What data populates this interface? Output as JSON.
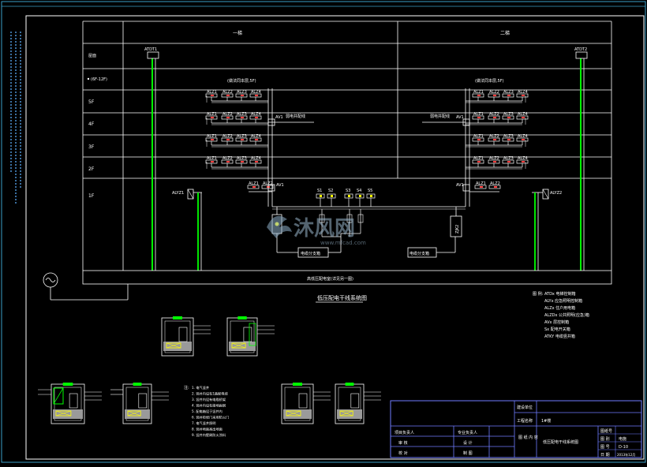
{
  "header": {
    "zone_left": "一梯",
    "zone_right": "二梯"
  },
  "floor_labels": [
    "屋面",
    "(6F-12F)",
    "5F",
    "4F",
    "3F",
    "2F",
    "1F"
  ],
  "risers": {
    "left_top": "ATDT1",
    "right_top": "ATDT2",
    "left_1f": "ALYZ1",
    "right_1f": "ALYZ2"
  },
  "group_notes": {
    "left": "(做法同本层,5F)",
    "right": "(做法同本层,5F)",
    "left_side": "弱电井配线",
    "right_side": "弱电井配线"
  },
  "meter_boxes": [
    "ALZ1",
    "ALZ2",
    "ALZ3",
    "ALZ4"
  ],
  "meter_boxes_1f_left": [
    "ALZ1",
    "ALZ2"
  ],
  "meter_boxes_1f_right": [
    "ALZ1",
    "ALZ2"
  ],
  "floor_box_left": "AV1",
  "floor_box_right": "AV1",
  "switches": [
    "S1",
    "S2",
    "S3",
    "S4",
    "S5"
  ],
  "cabinet_left": "电缆分支箱",
  "cabinet_right": "电缆分支箱",
  "riser_box": "ZJK2",
  "busbar_label": "高低压配电室(详见另一图)",
  "diagram_title": "低压配电干线系统图",
  "legend": {
    "title": "图 例:",
    "items": [
      "ATDx  电梯控制箱",
      "ALYx  应急照明控制箱",
      "ALZx  住户用电箱",
      "ALZDx  公共照明(应急)箱",
      "AVx  层控制箱",
      "Sx  配电开关箱",
      "ATKY  电缆竖井箱"
    ]
  },
  "notes": {
    "title": "注:",
    "items": [
      "1. 电气竖井",
      "2. 竖井内设有1路配电线",
      "3. 竖井内设有电缆桥架",
      "4. 竖井内设有接地扁钢",
      "5. 配电箱设于竖井内",
      "6. 竖井检修门采用防火门",
      "7. 电气竖井照明",
      "8. 竖井地面高出地面",
      "9. 竖井内壁刷防火涂料"
    ]
  },
  "title_block": {
    "project_label": "建设单位",
    "drawing_label": "工程名称",
    "building": "1#楼",
    "drawing_title": "低压配电干线系统图",
    "sig_1": "项目负责人",
    "sig_2": "审 核",
    "sig_3": "校 对",
    "sig_4": "专业负责人",
    "sig_5": "设 计",
    "sig_6": "制 图",
    "content_label": "图 纸\n内 容",
    "meta_1": "图纸号",
    "meta_2": "图 别",
    "meta_3": "图 号",
    "meta_4": "日 期",
    "meta_val_2": "电施",
    "meta_val_3": "D-10",
    "meta_val_4": "2013年12月"
  },
  "watermark": {
    "brand": "沐风网",
    "url": "www.mfcad.com"
  },
  "colors": {
    "background": "#000000",
    "line": "#ffffff",
    "frame": "#00ffff",
    "riser": "#00ff00",
    "accent_yellow": "#ffff00",
    "accent_red": "#ff3b3b",
    "title_block": "#6f7cff"
  }
}
